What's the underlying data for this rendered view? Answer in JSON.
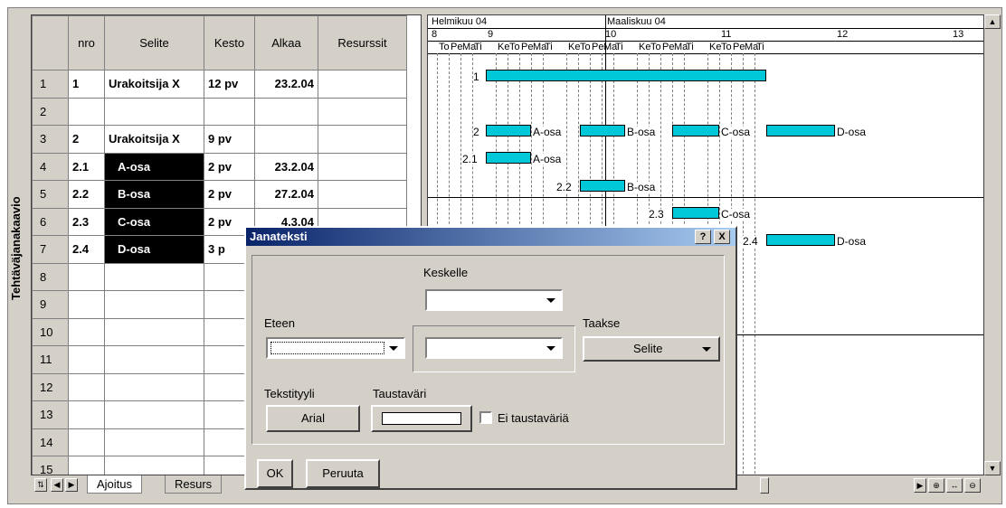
{
  "side_label": "Tehtäväjanakaavio",
  "columns": [
    "",
    "nro",
    "Selite",
    "Kesto",
    "Alkaa",
    "Resurssit"
  ],
  "rows": [
    {
      "n": "1",
      "nro": "1",
      "selite": "Urakoitsija X",
      "kesto": "12 pv",
      "alkaa": "23.2.04",
      "res": "",
      "style": "b"
    },
    {
      "n": "2",
      "nro": "",
      "selite": "",
      "kesto": "",
      "alkaa": "",
      "res": "",
      "style": ""
    },
    {
      "n": "3",
      "nro": "2",
      "selite": "Urakoitsija X",
      "kesto": "9 pv",
      "alkaa": "",
      "res": "",
      "style": "b"
    },
    {
      "n": "4",
      "nro": "2.1",
      "selite": "A-osa",
      "kesto": "2 pv",
      "alkaa": "23.2.04",
      "res": "",
      "style": "blk"
    },
    {
      "n": "5",
      "nro": "2.2",
      "selite": "B-osa",
      "kesto": "2 pv",
      "alkaa": "27.2.04",
      "res": "",
      "style": "blk"
    },
    {
      "n": "6",
      "nro": "2.3",
      "selite": "C-osa",
      "kesto": "2 pv",
      "alkaa": "4.3.04",
      "res": "",
      "style": "blk"
    },
    {
      "n": "7",
      "nro": "2.4",
      "selite": "D-osa",
      "kesto": "3 p",
      "alkaa": "",
      "res": "",
      "style": "blk"
    },
    {
      "n": "8"
    },
    {
      "n": "9"
    },
    {
      "n": "10"
    },
    {
      "n": "11"
    },
    {
      "n": "12"
    },
    {
      "n": "13"
    },
    {
      "n": "14"
    },
    {
      "n": "15"
    }
  ],
  "tabs": [
    "Ajoitus",
    "Resurs"
  ],
  "gantt": {
    "months": [
      "Helmikuu 04",
      "Maaliskuu 04"
    ],
    "weeks": [
      "8",
      "9",
      "10",
      "11",
      "12",
      "13"
    ],
    "days": [
      "To",
      "Pe",
      "Ma",
      "Ti",
      "Ke",
      "To",
      "Pe",
      "Ma",
      "Ti",
      "Ke",
      "To",
      "Pe",
      "Ma",
      "Ti",
      "Ke",
      "To",
      "Pe",
      "Ma",
      "Ti",
      "Ke",
      "To",
      "Pe",
      "Ma",
      "Ti"
    ],
    "labels": {
      "r1": "1",
      "r3": "2",
      "r4": "2.1",
      "r5": "2.2",
      "r6": "2.3",
      "r7": "2.4",
      "a": "A-osa",
      "b": "B-osa",
      "c": "C-osa",
      "d": "D-osa"
    }
  },
  "dialog": {
    "title": "Janateksti",
    "help": "?",
    "close": "X",
    "keskelle": "Keskelle",
    "eteen": "Eteen",
    "taakse": "Taakse",
    "taakse_value": "Selite",
    "tekstityyli": "Tekstityyli",
    "font_value": "Arial",
    "taustavari": "Taustaväri",
    "ei_taustavaria": "Ei taustaväriä",
    "ok": "OK",
    "cancel": "Peruuta"
  }
}
